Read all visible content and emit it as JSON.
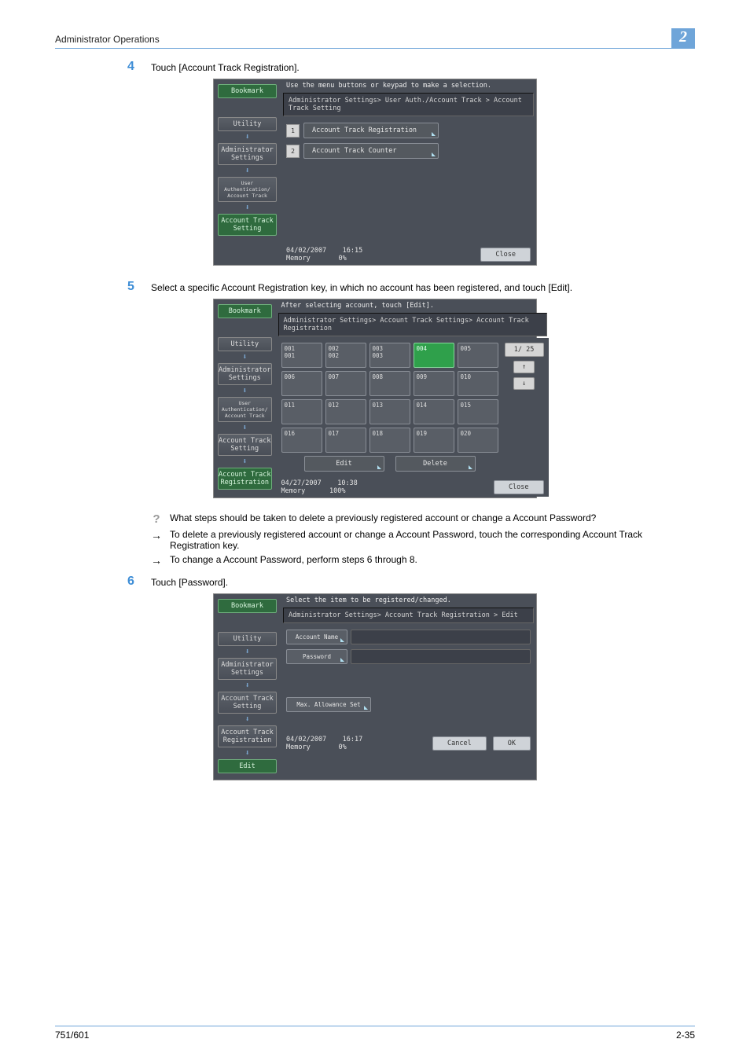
{
  "header": {
    "left": "Administrator Operations",
    "right": "2"
  },
  "footer": {
    "model": "751/601",
    "page": "2-35"
  },
  "steps": {
    "s4": {
      "num": "4",
      "text": "Touch [Account Track Registration]."
    },
    "s5": {
      "num": "5",
      "text": "Select a specific Account Registration key, in which no account has been registered, and touch [Edit]."
    },
    "s6": {
      "num": "6",
      "text": "Touch [Password]."
    }
  },
  "notes": {
    "q": "What steps should be taken to delete a previously registered account or change a Account Password?",
    "a1": "To delete a previously registered account or change a Account Password, touch the corresponding Account Track Registration key.",
    "a2": "To change a Account Password, perform steps 6 through 8."
  },
  "panel1": {
    "top": "Use the menu buttons or keypad to make a selection.",
    "breadcrumb": "Administrator Settings> User Auth./Account Track > Account Track Setting",
    "nav": {
      "bookmark": "Bookmark",
      "utility": "Utility",
      "admin": "Administrator Settings",
      "userauth": "User Authentication/ Account Track",
      "setting": "Account Track Setting"
    },
    "menu": {
      "i1": "1",
      "t1": "Account Track Registration",
      "i2": "2",
      "t2": "Account Track Counter"
    },
    "status": {
      "date": "04/02/2007",
      "time": "16:15",
      "mem": "Memory",
      "pct": "0%",
      "close": "Close"
    }
  },
  "panel2": {
    "top": "After selecting account, touch [Edit].",
    "breadcrumb": "Administrator Settings> Account Track Settings> Account Track Registration",
    "nav": {
      "bookmark": "Bookmark",
      "utility": "Utility",
      "admin": "Administrator Settings",
      "userauth": "User Authentication/ Account Track",
      "setting": "Account Track Setting",
      "reg": "Account Track Registration"
    },
    "cells": {
      "c1a": "001",
      "c1b": "001",
      "c2a": "002",
      "c2b": "002",
      "c3a": "003",
      "c3b": "003",
      "c4": "004",
      "c5": "005",
      "c6": "006",
      "c7": "007",
      "c8": "008",
      "c9": "009",
      "c10": "010",
      "c11": "011",
      "c12": "012",
      "c13": "013",
      "c14": "014",
      "c15": "015",
      "c16": "016",
      "c17": "017",
      "c18": "018",
      "c19": "019",
      "c20": "020"
    },
    "pager": {
      "pg": "1/ 25",
      "up": "↑",
      "down": "↓"
    },
    "actions": {
      "edit": "Edit",
      "delete": "Delete"
    },
    "status": {
      "date": "04/27/2007",
      "time": "10:38",
      "mem": "Memory",
      "pct": "100%",
      "close": "Close"
    }
  },
  "panel3": {
    "top": "Select the item to be registered/changed.",
    "breadcrumb": "Administrator Settings> Account Track Registration > Edit",
    "nav": {
      "bookmark": "Bookmark",
      "utility": "Utility",
      "admin": "Administrator Settings",
      "setting": "Account Track Setting",
      "reg": "Account Track Registration",
      "edit": "Edit"
    },
    "fields": {
      "acct": "Account Name",
      "pwd": "Password",
      "max": "Max. Allowance Set"
    },
    "status": {
      "date": "04/02/2007",
      "time": "16:17",
      "mem": "Memory",
      "pct": "0%",
      "cancel": "Cancel",
      "ok": "OK"
    }
  }
}
